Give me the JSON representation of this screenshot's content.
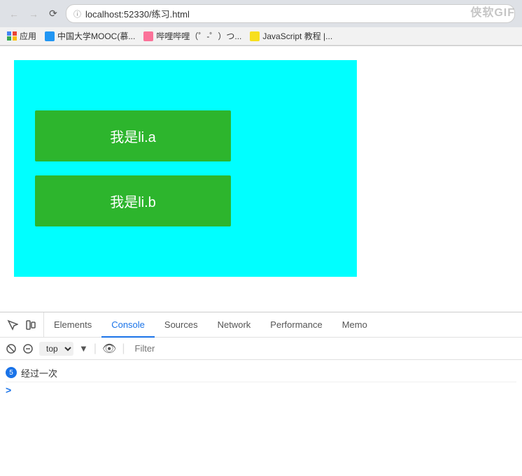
{
  "browser": {
    "back_disabled": true,
    "forward_disabled": true,
    "url": "localhost:52330/练习.html",
    "watermark": "侠软GIF"
  },
  "bookmarks": [
    {
      "id": "apps",
      "label": "应用",
      "icon_type": "apps"
    },
    {
      "id": "mooc",
      "label": "中国大学MOOC(慕...",
      "icon_type": "mooc"
    },
    {
      "id": "bili",
      "label": "哔哩哔哩（゜-゜）つ...",
      "icon_type": "bili"
    },
    {
      "id": "js",
      "label": "JavaScript 教程 |...",
      "icon_type": "js"
    }
  ],
  "webpage": {
    "items": [
      {
        "id": "li-a",
        "text": "我是li.a"
      },
      {
        "id": "li-b",
        "text": "我是li.b"
      }
    ]
  },
  "devtools": {
    "tabs": [
      {
        "id": "elements",
        "label": "Elements",
        "active": false
      },
      {
        "id": "console",
        "label": "Console",
        "active": true
      },
      {
        "id": "sources",
        "label": "Sources",
        "active": false
      },
      {
        "id": "network",
        "label": "Network",
        "active": false
      },
      {
        "id": "performance",
        "label": "Performance",
        "active": false
      },
      {
        "id": "memory",
        "label": "Memo",
        "active": false
      }
    ],
    "console": {
      "context": "top",
      "filter_placeholder": "Filter",
      "log_items": [
        {
          "badge": "5",
          "text": "经过一次"
        }
      ],
      "prompt": ">"
    }
  }
}
